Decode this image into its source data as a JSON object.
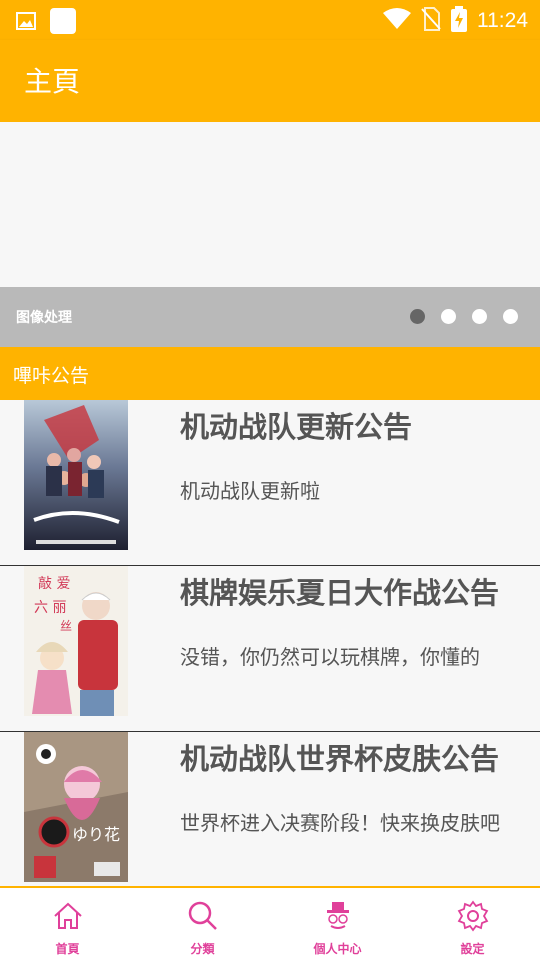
{
  "status_bar": {
    "time": "11:24",
    "icons": [
      "image-icon",
      "square-icon",
      "wifi-icon",
      "no-sim-icon",
      "battery-charging-icon"
    ]
  },
  "app_bar": {
    "title": "主頁"
  },
  "banner": {
    "caption": "图像处理",
    "page_count": 4,
    "active_page": 1
  },
  "section": {
    "title": "嗶咔公告"
  },
  "announcements": [
    {
      "title": "机动战队更新公告",
      "description": "机动战队更新啦"
    },
    {
      "title": "棋牌娱乐夏日大作战公告",
      "description": "没错，你仍然可以玩棋牌，你懂的"
    },
    {
      "title": "机动战队世界杯皮肤公告",
      "description": "世界杯进入决赛阶段！快来换皮肤吧"
    }
  ],
  "bottom_nav": [
    {
      "label": "首頁",
      "icon": "home-icon"
    },
    {
      "label": "分類",
      "icon": "search-icon"
    },
    {
      "label": "個人中心",
      "icon": "profile-hat-icon"
    },
    {
      "label": "設定",
      "icon": "gear-icon"
    }
  ],
  "colors": {
    "primary": "#FFB300",
    "nav_accent": "#e0409a",
    "caption_bar": "#b9b9b9",
    "text": "#555555"
  }
}
